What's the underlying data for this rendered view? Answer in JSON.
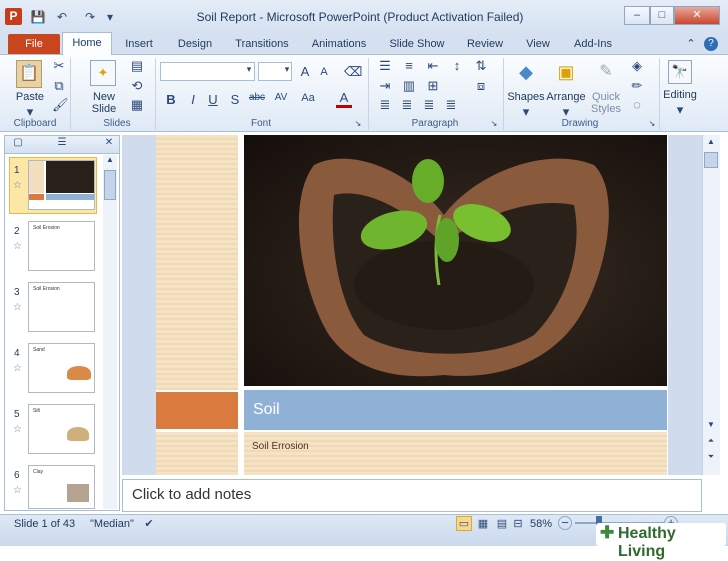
{
  "window": {
    "title": "Soil Report  -  Microsoft PowerPoint (Product Activation Failed)",
    "app_icon": "P",
    "minimize": "–",
    "maximize": "□",
    "close": "✕"
  },
  "tabs": [
    {
      "label": "File"
    },
    {
      "label": "Home"
    },
    {
      "label": "Insert"
    },
    {
      "label": "Design"
    },
    {
      "label": "Transitions"
    },
    {
      "label": "Animations"
    },
    {
      "label": "Slide Show"
    },
    {
      "label": "Review"
    },
    {
      "label": "View"
    },
    {
      "label": "Add-Ins"
    }
  ],
  "ribbon": {
    "clipboard": {
      "paste": "Paste",
      "group": "Clipboard"
    },
    "slides": {
      "new_slide": "New Slide",
      "new": "New",
      "slide": "Slide",
      "group": "Slides"
    },
    "font": {
      "group": "Font",
      "bold": "B",
      "italic": "I",
      "underline": "U",
      "shadow": "S",
      "strike": "abc",
      "spacing": "AV",
      "case": "Aa",
      "color": "A",
      "grow": "A",
      "shrink": "A"
    },
    "paragraph": {
      "group": "Paragraph"
    },
    "drawing": {
      "group": "Drawing",
      "shapes": "Shapes",
      "arrange": "Arrange",
      "quick_styles": "Quick Styles",
      "quick": "Quick",
      "styles": "Styles"
    },
    "editing": {
      "label": "Editing"
    }
  },
  "slides_panel": {
    "numbers": [
      "1",
      "2",
      "3",
      "4",
      "5",
      "6"
    ],
    "thumb_titles": [
      "",
      "Soil Erosion",
      "Soil Erosion",
      "Sand",
      "Silt",
      "Clay"
    ]
  },
  "slide": {
    "title": "Soil",
    "subtitle": "Soil Errosion"
  },
  "notes": {
    "placeholder": "Click to add notes"
  },
  "status": {
    "slide_info": "Slide 1 of 43",
    "theme": "\"Median\"",
    "zoom": "58%",
    "zoom_out": "−",
    "zoom_in": "+"
  },
  "watermark": "Healthy Living",
  "colors": {
    "accent": "#c8451e",
    "title_bar": "#8fb1d5",
    "orange": "#d97b3f"
  }
}
